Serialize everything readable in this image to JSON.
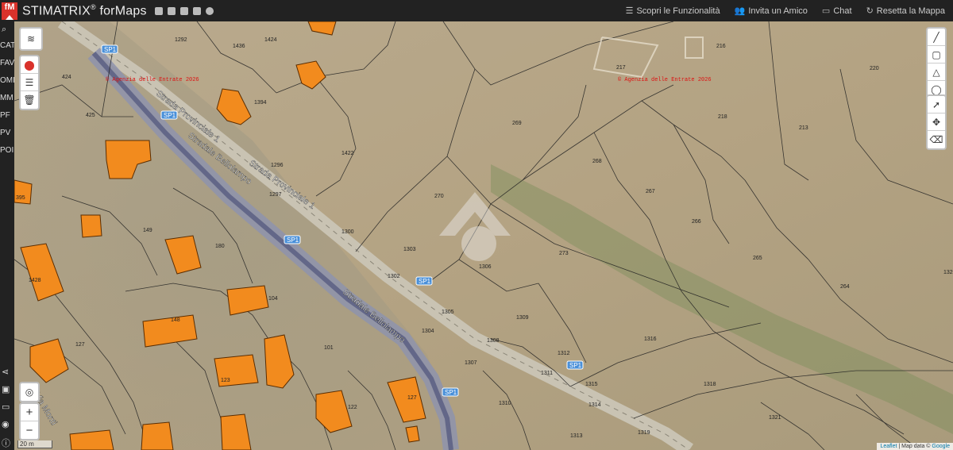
{
  "header": {
    "logo_text": "fM",
    "brand": "STIMATRIX",
    "brand_mark": "®",
    "brand_suffix": " forMaps",
    "social_icons": [
      "facebook-icon",
      "linkedin-icon",
      "youtube-icon",
      "instagram-icon",
      "other-icon"
    ],
    "nav": [
      {
        "icon": "list-icon",
        "label": "Scopri le Funzionalità"
      },
      {
        "icon": "users-icon",
        "label": "Invita un Amico"
      },
      {
        "icon": "chat-icon",
        "label": "Chat"
      },
      {
        "icon": "refresh-icon",
        "label": "Resetta la Mappa"
      }
    ]
  },
  "sidebar": {
    "items": [
      "CAT",
      "FAV",
      "OMI",
      "MM",
      "PF",
      "PV",
      "POI"
    ]
  },
  "map": {
    "road_shields": [
      "SP1",
      "SP1",
      "SP1",
      "SP1",
      "SP1",
      "SP1"
    ],
    "street_labels": [
      "Strada Provinciale 1",
      "Stradale Bellolampo",
      "Strada Provinciale 1",
      "Stradale Bellolampo",
      "Via Monti"
    ],
    "watermarks": [
      "© Agenzia delle Entrate 2026",
      "© Agenzia delle Entrate 2026"
    ],
    "parcel_numbers": [
      "1292",
      "1436",
      "1424",
      "424",
      "425",
      "1394",
      "1422",
      "1296",
      "1297",
      "395",
      "149",
      "180",
      "1428",
      "127",
      "104",
      "148",
      "101",
      "123",
      "127",
      "122",
      "1300",
      "1303",
      "1302",
      "1304",
      "1305",
      "1306",
      "270",
      "269",
      "268",
      "267",
      "266",
      "265",
      "264",
      "273",
      "1308",
      "1309",
      "1307",
      "1310",
      "1311",
      "1312",
      "1315",
      "1314",
      "1313",
      "1318",
      "1316",
      "1319",
      "1321",
      "217",
      "216",
      "218",
      "220",
      "213",
      "1320"
    ],
    "scale_label": "20 m",
    "attribution": {
      "leaflet": "Leaflet",
      "sep": " | Map data © ",
      "google": "Google"
    }
  },
  "colors": {
    "header_bg": "#222222",
    "building_fill": "#f28b1e",
    "brand_red": "#d9322b"
  }
}
